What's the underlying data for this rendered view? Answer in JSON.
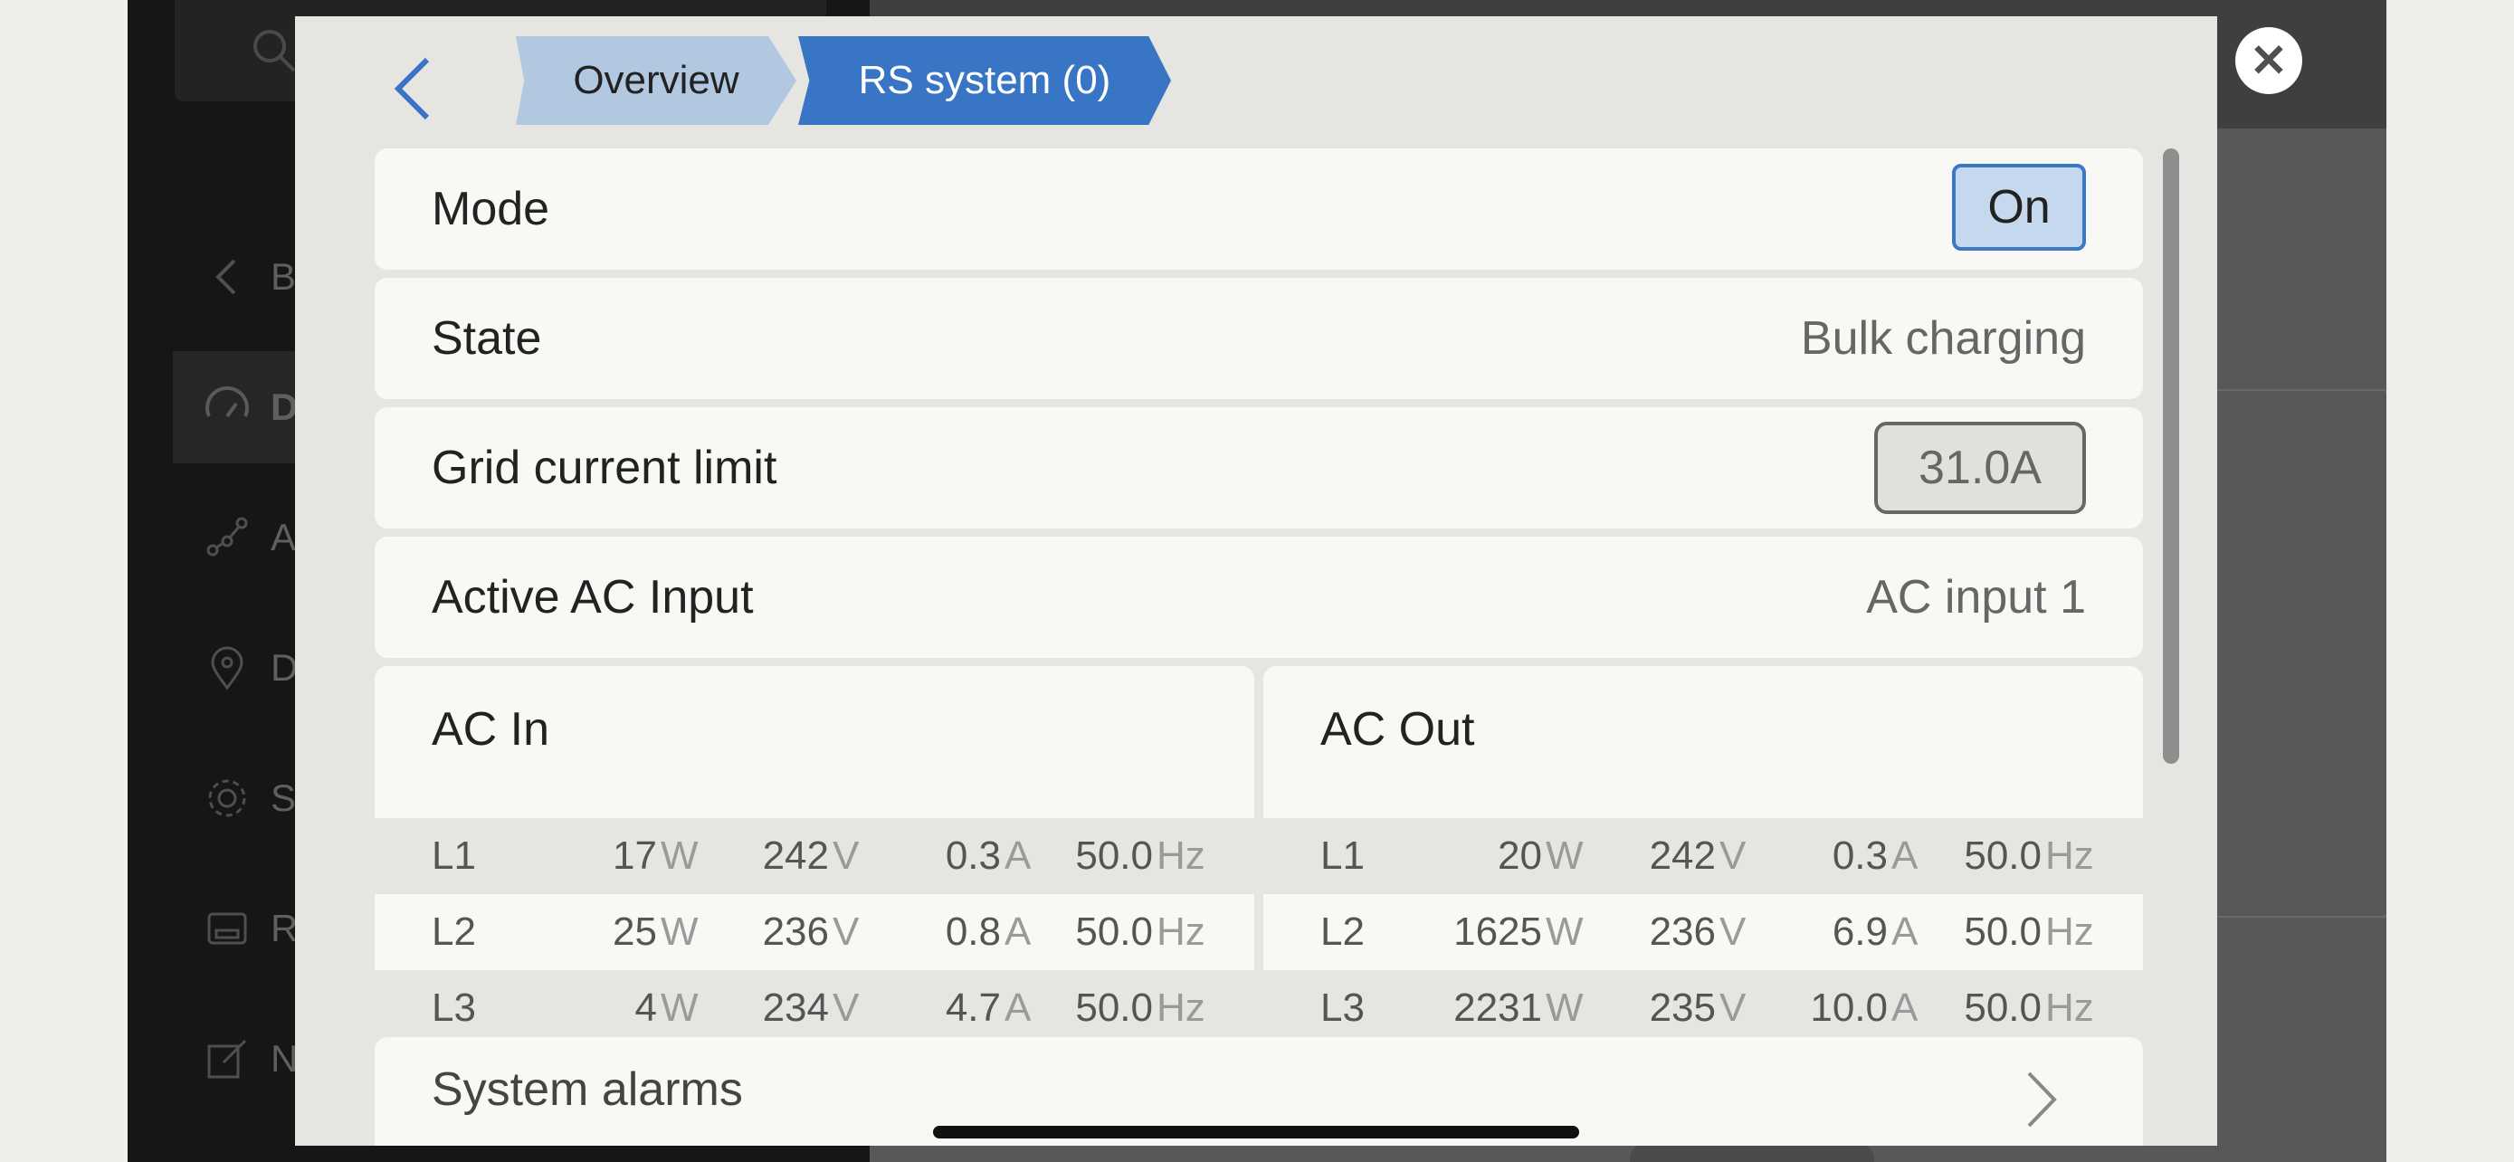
{
  "breadcrumbs": {
    "overview": "Overview",
    "current": "RS system (0)"
  },
  "rows": {
    "mode": {
      "label": "Mode",
      "value": "On"
    },
    "state": {
      "label": "State",
      "value": "Bulk charging"
    },
    "grid_limit": {
      "label": "Grid current limit",
      "value": "31.0A"
    },
    "active_input": {
      "label": "Active AC Input",
      "value": "AC input 1"
    }
  },
  "units": {
    "w": "W",
    "v": "V",
    "a": "A",
    "hz": "Hz"
  },
  "ac_in": {
    "title": "AC In",
    "lines": [
      {
        "phase": "L1",
        "power": "17",
        "voltage": "242",
        "current": "0.3",
        "freq": "50.0"
      },
      {
        "phase": "L2",
        "power": "25",
        "voltage": "236",
        "current": "0.8",
        "freq": "50.0"
      },
      {
        "phase": "L3",
        "power": "4",
        "voltage": "234",
        "current": "4.7",
        "freq": "50.0"
      }
    ]
  },
  "ac_out": {
    "title": "AC Out",
    "lines": [
      {
        "phase": "L1",
        "power": "20",
        "voltage": "242",
        "current": "0.3",
        "freq": "50.0"
      },
      {
        "phase": "L2",
        "power": "1625",
        "voltage": "236",
        "current": "6.9",
        "freq": "50.0"
      },
      {
        "phase": "L3",
        "power": "2231",
        "voltage": "235",
        "current": "10.0",
        "freq": "50.0"
      }
    ]
  },
  "alarms": {
    "label": "System alarms"
  },
  "background_sidebar": {
    "search_letter": "S",
    "items": [
      "Ba",
      "D",
      "Ac",
      "D",
      "Se",
      "Re",
      "N"
    ]
  },
  "icons": {
    "back": "chevron-left-icon",
    "close": "close-circle-icon",
    "alarms": "chevron-right-icon"
  },
  "colors": {
    "accent": "#3876c5",
    "crumb_inactive": "#b2c8e0",
    "row_bg": "#f9f8f5",
    "dialog_bg": "#e6e5e1"
  }
}
